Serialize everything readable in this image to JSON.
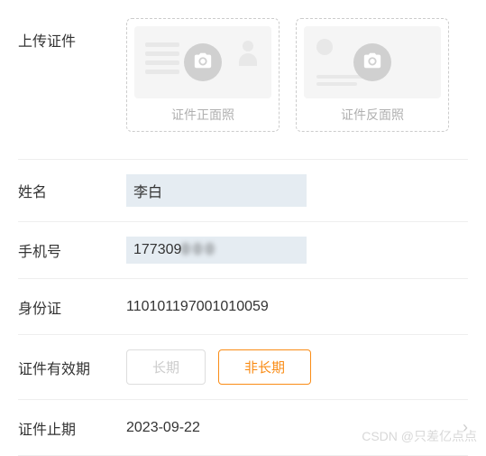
{
  "upload": {
    "label": "上传证件",
    "front_caption": "证件正面照",
    "back_caption": "证件反面照"
  },
  "fields": {
    "name": {
      "label": "姓名",
      "value": "李白"
    },
    "phone": {
      "label": "手机号",
      "value_visible": "177309",
      "value_obscured": "0 0 0"
    },
    "id_number": {
      "label": "身份证",
      "value": "110101197001010059"
    },
    "validity": {
      "label": "证件有效期",
      "option_long": "长期",
      "option_not_long": "非长期",
      "selected": "非长期"
    },
    "expire": {
      "label": "证件止期",
      "value": "2023-09-22"
    }
  },
  "watermark": "CSDN @只差亿点点"
}
